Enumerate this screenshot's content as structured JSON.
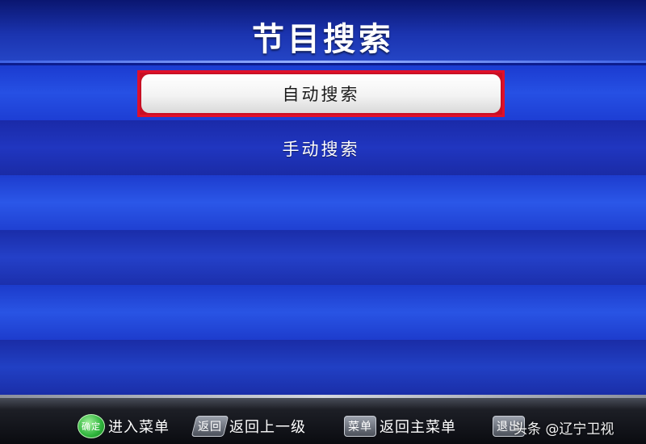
{
  "header": {
    "title": "节目搜索"
  },
  "menu": {
    "items": [
      {
        "label": "自动搜索",
        "selected": true
      },
      {
        "label": "手动搜索",
        "selected": false
      }
    ]
  },
  "footer": {
    "hints": [
      {
        "key": "确定",
        "label": "进入菜单"
      },
      {
        "key": "返回",
        "label": "返回上一级"
      },
      {
        "key": "菜单",
        "label": "返回主菜单"
      },
      {
        "key": "退出",
        "label": ""
      }
    ]
  },
  "watermark": {
    "text": "头条 @辽宁卫视"
  },
  "colors": {
    "background": "#0c1c8e",
    "selection_border": "#e0102a",
    "selected_item_bg": "#f3f3f3",
    "ok_key": "#2fb43c"
  }
}
